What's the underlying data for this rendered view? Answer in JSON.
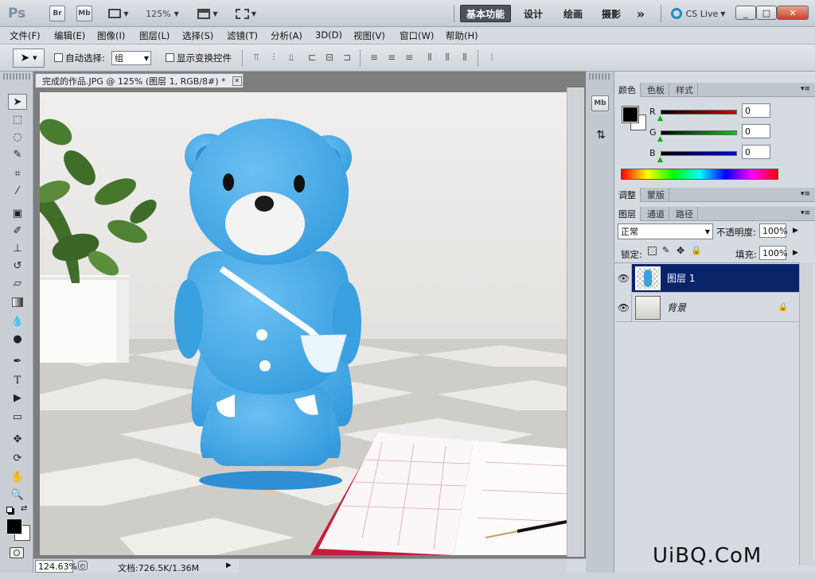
{
  "app": {
    "logo": "Ps",
    "zoom": "125%"
  },
  "titlebar": {
    "app_icons": [
      "Br",
      "Mb"
    ],
    "workspaces": [
      "基本功能",
      "设计",
      "绘画",
      "摄影"
    ],
    "more": "»",
    "cs_live": "CS Live",
    "window_buttons": [
      "_",
      "□",
      "✕"
    ]
  },
  "menu": [
    "文件(F)",
    "编辑(E)",
    "图像(I)",
    "图层(L)",
    "选择(S)",
    "滤镜(T)",
    "分析(A)",
    "3D(D)",
    "视图(V)",
    "窗口(W)",
    "帮助(H)"
  ],
  "options": {
    "auto_select_label": "自动选择:",
    "auto_select_value": "组",
    "show_transform_label": "显示变换控件"
  },
  "document": {
    "tab_title": "完成的作品.JPG @ 125% (图层 1, RGB/8#) *",
    "close": "✕",
    "status_zoom": "124.63%",
    "status_doc": "文档:726.5K/1.36M"
  },
  "color_panel": {
    "tabs": [
      "颜色",
      "色板",
      "样式"
    ],
    "channels": [
      {
        "label": "R",
        "value": "0",
        "color": "#d40000"
      },
      {
        "label": "G",
        "value": "0",
        "color": "#00b000"
      },
      {
        "label": "B",
        "value": "0",
        "color": "#0000d0"
      }
    ]
  },
  "adjust_panel": {
    "tabs": [
      "调整",
      "蒙版"
    ]
  },
  "layers_panel": {
    "tabs": [
      "图层",
      "通道",
      "路径"
    ],
    "blend_mode": "正常",
    "opacity_label": "不透明度:",
    "opacity_value": "100%",
    "lock_label": "锁定:",
    "fill_label": "填充:",
    "fill_value": "100%",
    "layers": [
      {
        "name": "图层 1",
        "selected": true
      },
      {
        "name": "背景",
        "selected": false,
        "locked": true
      }
    ]
  },
  "watermark": "UiBQ.CoM",
  "colors": {
    "accent": "#0a246a",
    "bear": "#45a8e6"
  }
}
